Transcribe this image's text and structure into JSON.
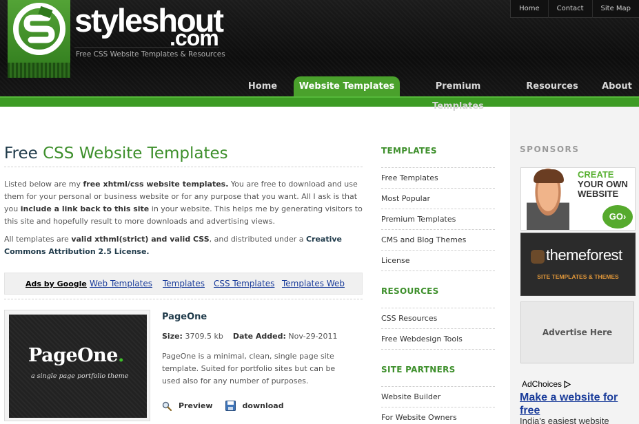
{
  "header": {
    "brand": "styleshout",
    "brand_suffix": ".com",
    "tagline": "Free CSS Website Templates & Resources",
    "top_links": [
      "Home",
      "Contact",
      "Site Map"
    ],
    "nav": [
      {
        "label": "Home",
        "active": false
      },
      {
        "label": "Website Templates",
        "active": true
      },
      {
        "label": "Premium Templates",
        "active": false
      },
      {
        "label": "Resources",
        "active": false
      },
      {
        "label": "About",
        "active": false
      }
    ]
  },
  "main": {
    "title_prefix": "Free",
    "title_highlight": "CSS Website Templates",
    "intro": {
      "t1": "Listed below are my ",
      "b1": "free xhtml/css website templates.",
      "t2": " You are free to download and use them for your personal or business website or for any purpose that you want. All I ask is that you ",
      "b2": "include a link back to this site",
      "t3": " in your website. This helps me by generating visitors to this site and hopefully result to more downloads and advertising views."
    },
    "intro2": {
      "t1": "All templates are ",
      "b1": "valid xthml(strict) and valid CSS",
      "t2": ", and distributed under a ",
      "b2": "Creative Commons Attribution 2.5 License."
    },
    "ads": {
      "label": "Ads by Google",
      "links": [
        "Web Templates",
        "Templates",
        "CSS Templates",
        "Templates Web"
      ]
    },
    "template": {
      "thumb_title": "PageOne",
      "thumb_dot": ".",
      "thumb_sub": "a single page portfolio theme",
      "name": "PageOne",
      "size_label": "Size:",
      "size_value": "3709.5 kb",
      "date_label": "Date Added:",
      "date_value": "Nov-29-2011",
      "description": "PageOne is a minimal, clean, single page site template. Suited for portfolio sites but can be used also for any number of purposes.",
      "preview_label": "Preview",
      "download_label": "download"
    }
  },
  "sidebar": {
    "templates_heading": "TEMPLATES",
    "templates": [
      "Free Templates",
      "Most Popular",
      "Premium Templates",
      "CMS and Blog Themes",
      "License"
    ],
    "resources_heading": "RESOURCES",
    "resources": [
      "CSS Resources",
      "Free Webdesign Tools"
    ],
    "partners_heading": "SITE PARTNERS",
    "partners": [
      "Website Builder",
      "For Website Owners"
    ]
  },
  "sponsors": {
    "heading": "SPONSORS",
    "ad1": {
      "line1": "CREATE",
      "line2": "YOUR OWN",
      "line3": "WEBSITE",
      "go": "GO›"
    },
    "ad2": {
      "brand": "themeforest",
      "sub": "SITE TEMPLATES & THEMES"
    },
    "ad3": "Advertise Here",
    "adchoices": "AdChoices",
    "ad_link": "Make a website for free",
    "ad_sub": "India's easiest website"
  },
  "colors": {
    "accent_green": "#3d9b24",
    "heading_blue": "#1f3a4a",
    "link_blue": "#1a3c9a"
  }
}
